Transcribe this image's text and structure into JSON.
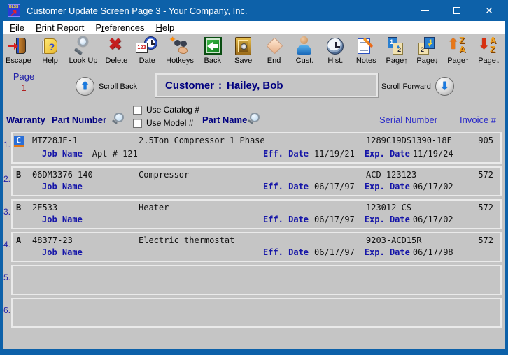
{
  "window": {
    "title": "Customer Update Screen Page 3 - Your Company, Inc.",
    "close_glyph": "✕"
  },
  "menu": {
    "items": [
      {
        "pre": "",
        "accel": "F",
        "post": "ile"
      },
      {
        "pre": "",
        "accel": "P",
        "post": "rint Report"
      },
      {
        "pre": "P",
        "accel": "r",
        "post": "eferences"
      },
      {
        "pre": "",
        "accel": "H",
        "post": "elp"
      }
    ]
  },
  "toolbar": {
    "buttons": [
      {
        "pre": "Escape",
        "accel": "",
        "post": ""
      },
      {
        "pre": "Help",
        "accel": "",
        "post": ""
      },
      {
        "pre": "Look Up",
        "accel": "",
        "post": ""
      },
      {
        "pre": "Delete",
        "accel": "",
        "post": ""
      },
      {
        "pre": "Date",
        "accel": "",
        "post": ""
      },
      {
        "pre": "Hotkeys",
        "accel": "",
        "post": ""
      },
      {
        "pre": "Back",
        "accel": "",
        "post": ""
      },
      {
        "pre": "Save",
        "accel": "",
        "post": ""
      },
      {
        "pre": "End",
        "accel": "",
        "post": ""
      },
      {
        "pre": "",
        "accel": "C",
        "post": "ust."
      },
      {
        "pre": "His",
        "accel": "t",
        "post": "."
      },
      {
        "pre": "No",
        "accel": "t",
        "post": "es"
      },
      {
        "pre": "Page↑",
        "accel": "",
        "post": ""
      },
      {
        "pre": "Page↓",
        "accel": "",
        "post": ""
      },
      {
        "pre": "Page↑",
        "accel": "",
        "post": ""
      },
      {
        "pre": "Page↓",
        "accel": "",
        "post": ""
      }
    ]
  },
  "page_panel": {
    "label": "Page",
    "number": "1"
  },
  "scroll": {
    "back_label": "Scroll Back",
    "forward_label": "Scroll Forward",
    "up_glyph": "⬆",
    "down_glyph": "⬇"
  },
  "customer": {
    "label": "Customer",
    "separator": ":",
    "name": "Hailey, Bob"
  },
  "filters": {
    "catalog_label": "Use Catalog #",
    "model_label": "Use Model #"
  },
  "columns": {
    "warranty": "Warranty",
    "part_number": "Part Number",
    "part_name": "Part Name",
    "serial_number": "Serial Number",
    "invoice": "Invoice #"
  },
  "rows": [
    {
      "num": "1.",
      "warranty": "C",
      "part_number": "MTZ28JE-1",
      "part_name": "2.5Ton Compressor 1 Phase",
      "serial": "1289C19DS1390-18E",
      "invoice": "905",
      "job_label": "Job Name",
      "job_value": "Apt # 121",
      "eff_label": "Eff. Date",
      "eff_date": "11/19/21",
      "exp_label": "Exp. Date",
      "exp_date": "11/19/24"
    },
    {
      "num": "2.",
      "warranty": "B",
      "part_number": "06DM3376-140",
      "part_name": "Compressor",
      "serial": "ACD-123123",
      "invoice": "572",
      "job_label": "Job Name",
      "job_value": "",
      "eff_label": "Eff. Date",
      "eff_date": "06/17/97",
      "exp_label": "Exp. Date",
      "exp_date": "06/17/02"
    },
    {
      "num": "3.",
      "warranty": "B",
      "part_number": "2E533",
      "part_name": "Heater",
      "serial": "123012-CS",
      "invoice": "572",
      "job_label": "Job Name",
      "job_value": "",
      "eff_label": "Eff. Date",
      "eff_date": "06/17/97",
      "exp_label": "Exp. Date",
      "exp_date": "06/17/02"
    },
    {
      "num": "4.",
      "warranty": "A",
      "part_number": "48377-23",
      "part_name": "Electric thermostat",
      "serial": "9203-ACD15R",
      "invoice": "572",
      "job_label": "Job Name",
      "job_value": "",
      "eff_label": "Eff. Date",
      "eff_date": "06/17/97",
      "exp_label": "Exp. Date",
      "exp_date": "06/17/98"
    },
    {
      "num": "5.",
      "warranty": "",
      "part_number": "",
      "part_name": "",
      "serial": "",
      "invoice": "",
      "job_label": "",
      "job_value": "",
      "eff_label": "",
      "eff_date": "",
      "exp_label": "",
      "exp_date": ""
    },
    {
      "num": "6.",
      "warranty": "",
      "part_number": "",
      "part_name": "",
      "serial": "",
      "invoice": "",
      "job_label": "",
      "job_value": "",
      "eff_label": "",
      "eff_date": "",
      "exp_label": "",
      "exp_date": ""
    }
  ]
}
